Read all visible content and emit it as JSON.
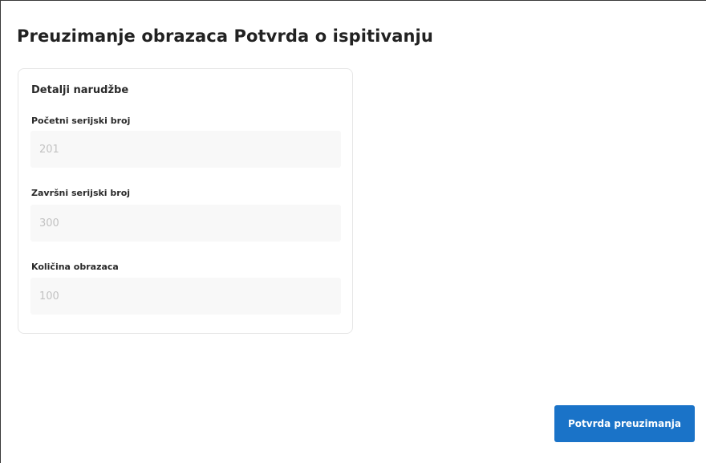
{
  "page": {
    "title": "Preuzimanje obrazaca Potvrda o ispitivanju"
  },
  "order_details": {
    "title": "Detalji narudžbe",
    "fields": [
      {
        "label": "Početni serijski broj",
        "value": "201"
      },
      {
        "label": "Završni serijski broj",
        "value": "300"
      },
      {
        "label": "Količina obrazaca",
        "value": "100"
      }
    ]
  },
  "actions": {
    "confirm_label": "Potvrda preuzimanja"
  },
  "colors": {
    "primary_button": "#1a73c8",
    "field_background": "#f8f8f8",
    "disabled_text": "#c2c2c2"
  }
}
